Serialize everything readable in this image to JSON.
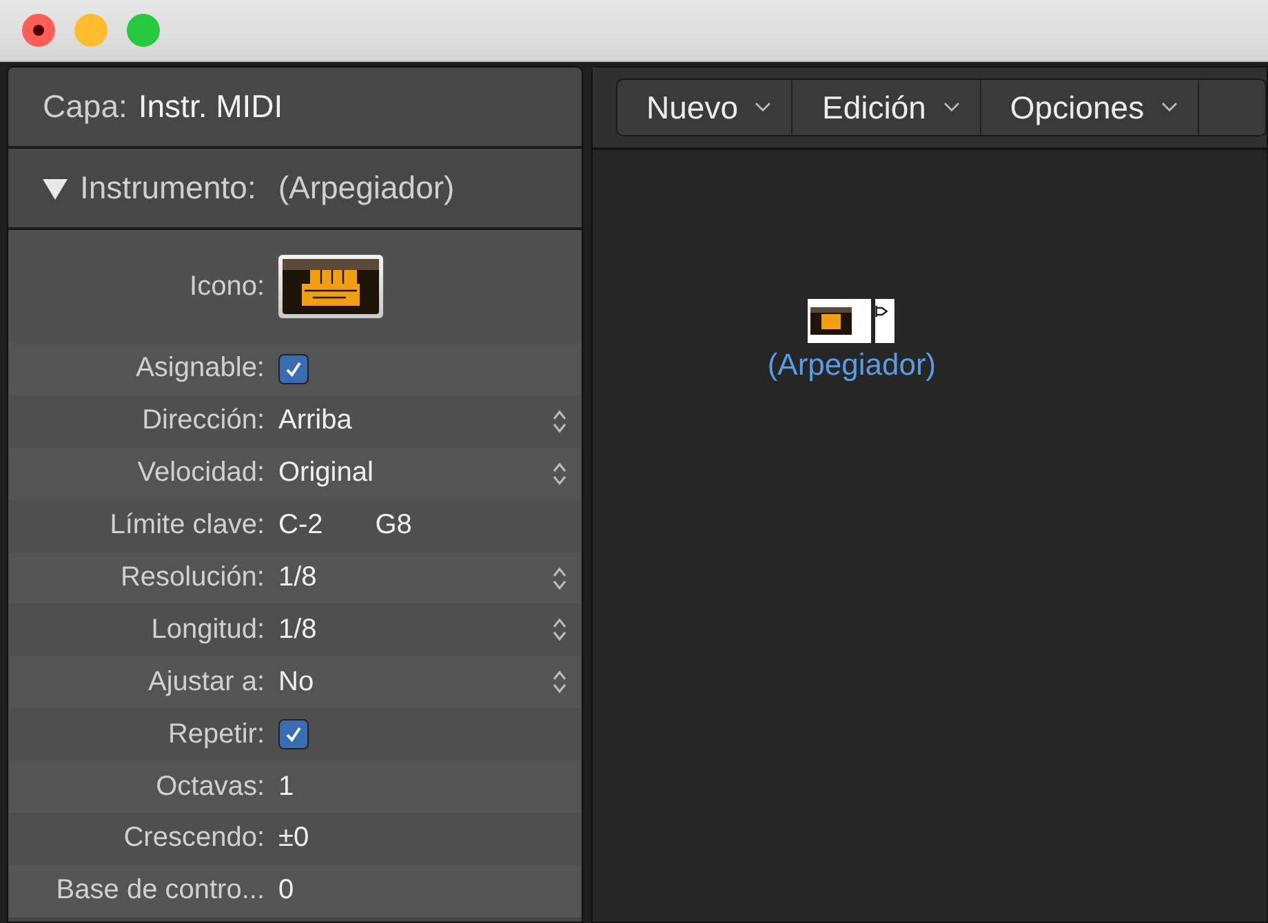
{
  "inspector": {
    "layer_label": "Capa:",
    "layer_value": "Instr. MIDI",
    "section": {
      "expanded": true,
      "label": "Instrumento:",
      "value": "(Arpegiador)"
    },
    "rows": [
      {
        "kind": "icon",
        "label": "Icono:"
      },
      {
        "kind": "checkbox",
        "label": "Asignable:",
        "checked": true
      },
      {
        "kind": "popup",
        "label": "Dirección:",
        "value": "Arriba"
      },
      {
        "kind": "popup",
        "label": "Velocidad:",
        "value": "Original"
      },
      {
        "kind": "range",
        "label": "Límite clave:",
        "low": "C-2",
        "high": "G8"
      },
      {
        "kind": "popup",
        "label": "Resolución:",
        "value": "1/8"
      },
      {
        "kind": "popup",
        "label": "Longitud:",
        "value": "1/8"
      },
      {
        "kind": "popup",
        "label": "Ajustar a:",
        "value": "No"
      },
      {
        "kind": "checkbox",
        "label": "Repetir:",
        "checked": true
      },
      {
        "kind": "value",
        "label": "Octavas:",
        "value": "1"
      },
      {
        "kind": "value",
        "label": "Crescendo:",
        "value": "±0"
      },
      {
        "kind": "value",
        "label": "Base de contro...",
        "value": "0"
      }
    ]
  },
  "toolbar": {
    "menus": [
      "Nuevo",
      "Edición",
      "Opciones"
    ]
  },
  "canvas": {
    "node": {
      "label": "(Arpegiador)"
    }
  }
}
